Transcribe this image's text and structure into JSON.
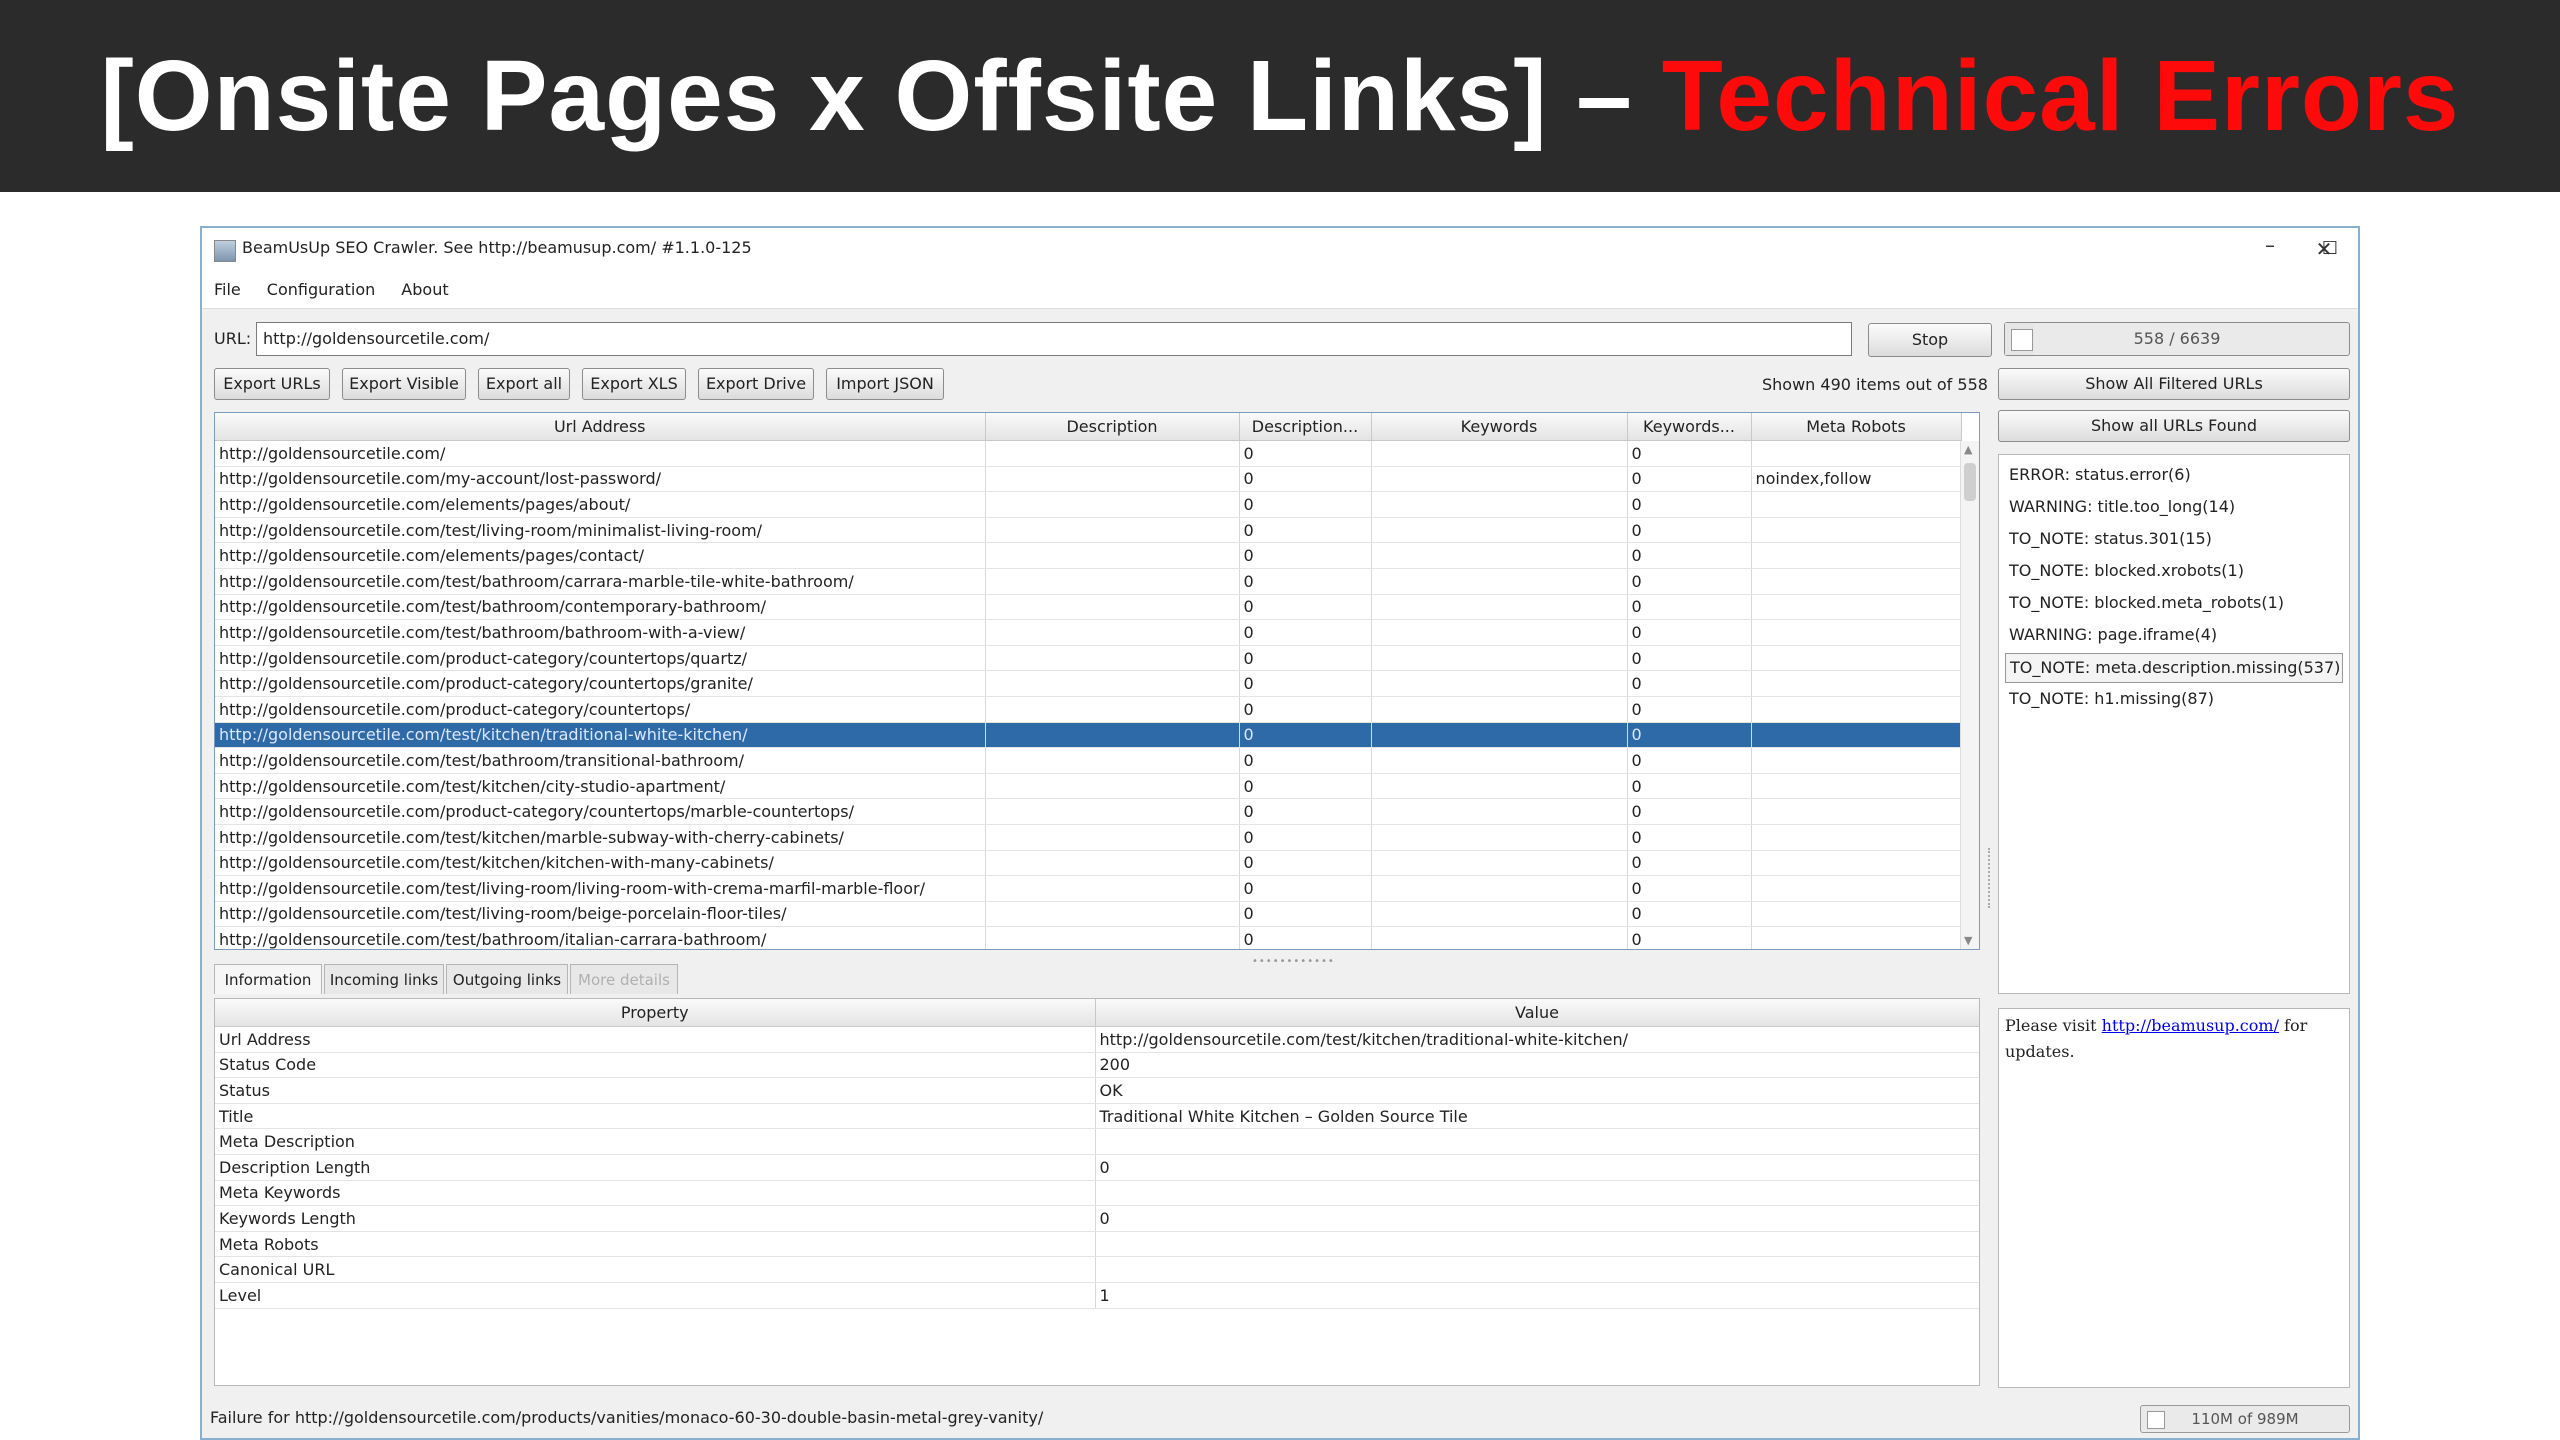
{
  "banner": {
    "title_prefix": "[Onsite Pages x Offsite Links] – ",
    "title_highlight": "Technical Errors",
    "highlight_color": "#ff0a0a"
  },
  "window": {
    "title": "BeamUsUp SEO Crawler. See http://beamusup.com/ #1.1.0-125",
    "minimize": "–",
    "maximize": "☐",
    "close": "✕"
  },
  "menu": [
    "File",
    "Configuration",
    "About"
  ],
  "url_label": "URL:",
  "url_value": "http://goldensourcetile.com/",
  "stop_label": "Stop",
  "progress": {
    "text": "558 / 6639",
    "fraction": 0.084
  },
  "toolbar": [
    "Export URLs",
    "Export Visible",
    "Export all",
    "Export XLS",
    "Export Drive",
    "Import JSON"
  ],
  "shown_text": "Shown 490 items out of 558",
  "side_buttons": {
    "filtered": "Show All Filtered URLs",
    "all": "Show all URLs Found"
  },
  "columns": [
    "Url Address",
    "Description",
    "Description...",
    "Keywords",
    "Keywords...",
    "Meta Robots"
  ],
  "rows": [
    [
      "http://goldensourcetile.com/",
      "",
      "0",
      "",
      "0",
      ""
    ],
    [
      "http://goldensourcetile.com/my-account/lost-password/",
      "",
      "0",
      "",
      "0",
      "noindex,follow"
    ],
    [
      "http://goldensourcetile.com/elements/pages/about/",
      "",
      "0",
      "",
      "0",
      ""
    ],
    [
      "http://goldensourcetile.com/test/living-room/minimalist-living-room/",
      "",
      "0",
      "",
      "0",
      ""
    ],
    [
      "http://goldensourcetile.com/elements/pages/contact/",
      "",
      "0",
      "",
      "0",
      ""
    ],
    [
      "http://goldensourcetile.com/test/bathroom/carrara-marble-tile-white-bathroom/",
      "",
      "0",
      "",
      "0",
      ""
    ],
    [
      "http://goldensourcetile.com/test/bathroom/contemporary-bathroom/",
      "",
      "0",
      "",
      "0",
      ""
    ],
    [
      "http://goldensourcetile.com/test/bathroom/bathroom-with-a-view/",
      "",
      "0",
      "",
      "0",
      ""
    ],
    [
      "http://goldensourcetile.com/product-category/countertops/quartz/",
      "",
      "0",
      "",
      "0",
      ""
    ],
    [
      "http://goldensourcetile.com/product-category/countertops/granite/",
      "",
      "0",
      "",
      "0",
      ""
    ],
    [
      "http://goldensourcetile.com/product-category/countertops/",
      "",
      "0",
      "",
      "0",
      ""
    ],
    [
      "http://goldensourcetile.com/test/kitchen/traditional-white-kitchen/",
      "",
      "0",
      "",
      "0",
      ""
    ],
    [
      "http://goldensourcetile.com/test/bathroom/transitional-bathroom/",
      "",
      "0",
      "",
      "0",
      ""
    ],
    [
      "http://goldensourcetile.com/test/kitchen/city-studio-apartment/",
      "",
      "0",
      "",
      "0",
      ""
    ],
    [
      "http://goldensourcetile.com/product-category/countertops/marble-countertops/",
      "",
      "0",
      "",
      "0",
      ""
    ],
    [
      "http://goldensourcetile.com/test/kitchen/marble-subway-with-cherry-cabinets/",
      "",
      "0",
      "",
      "0",
      ""
    ],
    [
      "http://goldensourcetile.com/test/kitchen/kitchen-with-many-cabinets/",
      "",
      "0",
      "",
      "0",
      ""
    ],
    [
      "http://goldensourcetile.com/test/living-room/living-room-with-crema-marfil-marble-floor/",
      "",
      "0",
      "",
      "0",
      ""
    ],
    [
      "http://goldensourcetile.com/test/living-room/beige-porcelain-floor-tiles/",
      "",
      "0",
      "",
      "0",
      ""
    ],
    [
      "http://goldensourcetile.com/test/bathroom/italian-carrara-bathroom/",
      "",
      "0",
      "",
      "0",
      ""
    ]
  ],
  "selected_row": 11,
  "issues": [
    "ERROR: status.error(6)",
    "WARNING: title.too_long(14)",
    "TO_NOTE: status.301(15)",
    "TO_NOTE: blocked.xrobots(1)",
    "TO_NOTE: blocked.meta_robots(1)",
    "WARNING: page.iframe(4)",
    "TO_NOTE: meta.description.missing(537)",
    "TO_NOTE: h1.missing(87)"
  ],
  "selected_issue": 6,
  "tabs": [
    "Information",
    "Incoming links",
    "Outgoing links",
    "More details"
  ],
  "prop_columns": [
    "Property",
    "Value"
  ],
  "properties": [
    [
      "Url Address",
      "http://goldensourcetile.com/test/kitchen/traditional-white-kitchen/"
    ],
    [
      "Status Code",
      "200"
    ],
    [
      "Status",
      "OK"
    ],
    [
      "Title",
      "Traditional White Kitchen – Golden Source Tile"
    ],
    [
      "Meta Description",
      ""
    ],
    [
      "Description Length",
      "0"
    ],
    [
      "Meta Keywords",
      ""
    ],
    [
      "Keywords Length",
      "0"
    ],
    [
      "Meta Robots",
      ""
    ],
    [
      "Canonical URL",
      ""
    ],
    [
      "Level",
      "1"
    ]
  ],
  "info": {
    "prefix": "Please visit ",
    "link": "http://beamusup.com/",
    "suffix": " for updates."
  },
  "status_text": "Failure for http://goldensourcetile.com/products/vanities/monaco-60-30-double-basin-metal-grey-vanity/",
  "memory": "110M of 989M"
}
